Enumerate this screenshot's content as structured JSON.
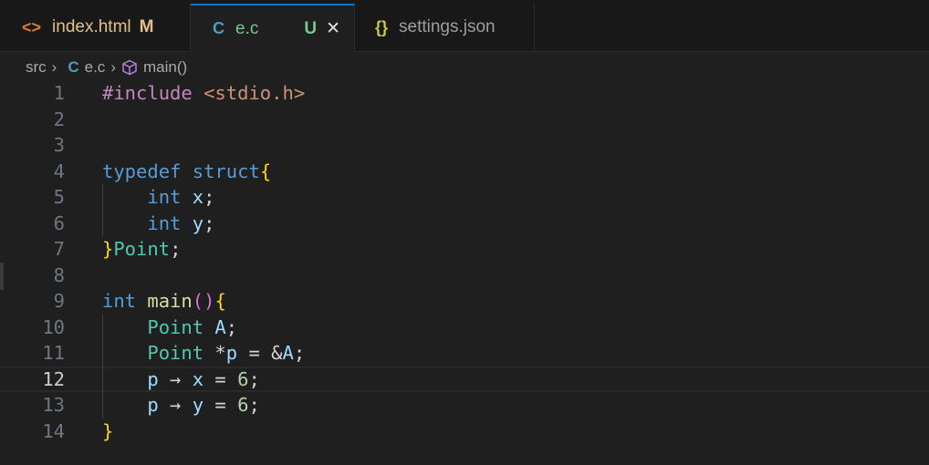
{
  "tabs": [
    {
      "icon": "<>",
      "icon_color": "#e37933",
      "label": "index.html",
      "label_color": "#e2c08d",
      "status": "M",
      "status_color": "#e2c08d",
      "active": false
    },
    {
      "icon": "C",
      "icon_color": "#519aba",
      "label": "e.c",
      "label_color": "#73c991",
      "status": "U",
      "status_color": "#73c991",
      "close": "✕",
      "active": true
    },
    {
      "icon": "{}",
      "icon_color": "#cbcb41",
      "label": "settings.json",
      "label_color": "#9d9d9d",
      "active": false
    }
  ],
  "breadcrumb": {
    "folder": "src",
    "file_icon": "C",
    "file": "e.c",
    "symbol": "main()"
  },
  "colors": {
    "keyword": "#569cd6",
    "type": "#4ec9b0",
    "func": "#dcdcaa",
    "var": "#9cdcfe",
    "num": "#b5cea8",
    "str": "#ce9178",
    "pre": "#c586c0",
    "brace1": "#ffd700",
    "brace2": "#da70d6",
    "plain": "#d4d4d4"
  },
  "lines": [
    {
      "n": "1",
      "tokens": [
        [
          "#include ",
          "pre"
        ],
        [
          "<stdio.h>",
          "str"
        ]
      ]
    },
    {
      "n": "2",
      "tokens": []
    },
    {
      "n": "3",
      "tokens": []
    },
    {
      "n": "4",
      "tokens": [
        [
          "typedef ",
          "keyword"
        ],
        [
          "struct",
          "keyword"
        ],
        [
          "{",
          "brace1"
        ]
      ]
    },
    {
      "n": "5",
      "tokens": [
        [
          "    int ",
          "keyword"
        ],
        [
          "x",
          "var"
        ],
        [
          ";",
          "plain"
        ]
      ]
    },
    {
      "n": "6",
      "tokens": [
        [
          "    int ",
          "keyword"
        ],
        [
          "y",
          "var"
        ],
        [
          ";",
          "plain"
        ]
      ]
    },
    {
      "n": "7",
      "tokens": [
        [
          "}",
          "brace1"
        ],
        [
          "Point",
          "type"
        ],
        [
          ";",
          "plain"
        ]
      ]
    },
    {
      "n": "8",
      "tokens": []
    },
    {
      "n": "9",
      "tokens": [
        [
          "int ",
          "keyword"
        ],
        [
          "main",
          "func"
        ],
        [
          "()",
          "brace2"
        ],
        [
          "{",
          "brace1"
        ]
      ]
    },
    {
      "n": "10",
      "tokens": [
        [
          "    Point ",
          "type"
        ],
        [
          "A",
          "var"
        ],
        [
          ";",
          "plain"
        ]
      ]
    },
    {
      "n": "11",
      "tokens": [
        [
          "    Point ",
          "type"
        ],
        [
          "*",
          "plain"
        ],
        [
          "p",
          "var"
        ],
        [
          " = &",
          "plain"
        ],
        [
          "A",
          "var"
        ],
        [
          ";",
          "plain"
        ]
      ]
    },
    {
      "n": "12",
      "current": true,
      "tokens": [
        [
          "    p",
          "var"
        ],
        [
          " → ",
          "plain"
        ],
        [
          "x",
          "var"
        ],
        [
          " = ",
          "plain"
        ],
        [
          "6",
          "num"
        ],
        [
          ";",
          "plain"
        ]
      ]
    },
    {
      "n": "13",
      "tokens": [
        [
          "    p",
          "var"
        ],
        [
          " → ",
          "plain"
        ],
        [
          "y",
          "var"
        ],
        [
          " = ",
          "plain"
        ],
        [
          "6",
          "num"
        ],
        [
          ";",
          "plain"
        ]
      ]
    },
    {
      "n": "14",
      "tokens": [
        [
          "}",
          "brace1"
        ]
      ]
    }
  ]
}
